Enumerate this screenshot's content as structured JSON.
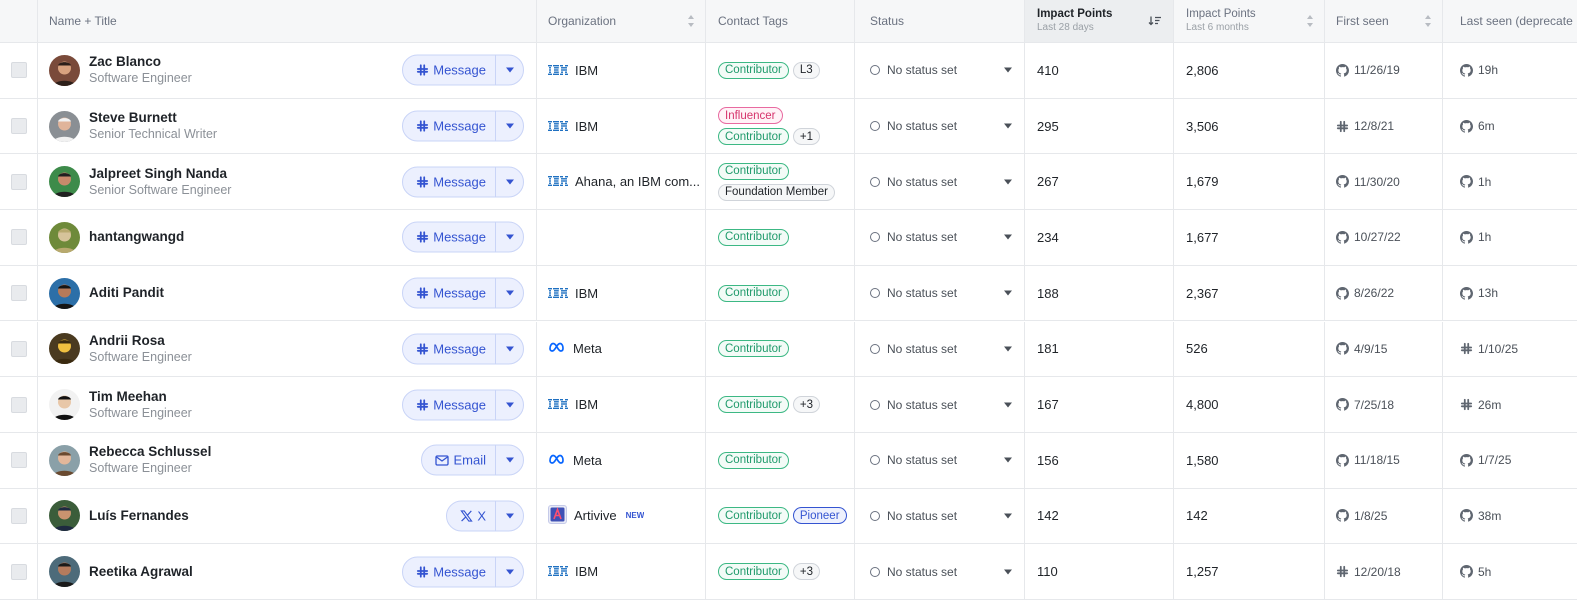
{
  "columns": {
    "name_title": "Name + Title",
    "organization": "Organization",
    "contact_tags": "Contact Tags",
    "status": "Status",
    "impact_28": "Impact Points",
    "impact_28_sub": "Last 28 days",
    "impact_6m": "Impact Points",
    "impact_6m_sub": "Last 6 months",
    "first_seen": "First seen",
    "last_seen": "Last seen (deprecate"
  },
  "status_text": "No status set",
  "rows": [
    {
      "name": "Zac Blanco",
      "title": "Software Engineer",
      "action": "Message",
      "action_icon": "slack-icon",
      "org": "IBM",
      "org_logo": "ibm-logo",
      "tags": [
        {
          "label": "Contributor",
          "kind": "contributor"
        },
        {
          "label": "L3",
          "kind": "gray"
        }
      ],
      "impact_28": "410",
      "impact_6m": "2,806",
      "first_seen": "11/26/19",
      "first_icon": "github-icon",
      "last_seen": "19h",
      "last_icon": "github-icon"
    },
    {
      "name": "Steve Burnett",
      "title": "Senior Technical Writer",
      "action": "Message",
      "action_icon": "slack-icon",
      "org": "IBM",
      "org_logo": "ibm-logo",
      "tags": [
        {
          "label": "Influencer",
          "kind": "influencer"
        },
        {
          "label": "Contributor",
          "kind": "contributor"
        },
        {
          "label": "+1",
          "kind": "gray"
        }
      ],
      "impact_28": "295",
      "impact_6m": "3,506",
      "first_seen": "12/8/21",
      "first_icon": "slack-icon",
      "last_seen": "6m",
      "last_icon": "github-icon"
    },
    {
      "name": "Jalpreet Singh Nanda",
      "title": "Senior Software Engineer",
      "action": "Message",
      "action_icon": "slack-icon",
      "org": "Ahana, an IBM com...",
      "org_logo": "ibm-logo",
      "tags": [
        {
          "label": "Contributor",
          "kind": "contributor"
        },
        {
          "label": "Foundation Member",
          "kind": "gray"
        }
      ],
      "impact_28": "267",
      "impact_6m": "1,679",
      "first_seen": "11/30/20",
      "first_icon": "github-icon",
      "last_seen": "1h",
      "last_icon": "github-icon"
    },
    {
      "name": "hantangwangd",
      "title": "",
      "action": "Message",
      "action_icon": "slack-icon",
      "org": "",
      "org_logo": "",
      "tags": [
        {
          "label": "Contributor",
          "kind": "contributor"
        }
      ],
      "impact_28": "234",
      "impact_6m": "1,677",
      "first_seen": "10/27/22",
      "first_icon": "github-icon",
      "last_seen": "1h",
      "last_icon": "github-icon"
    },
    {
      "name": "Aditi Pandit",
      "title": "",
      "action": "Message",
      "action_icon": "slack-icon",
      "org": "IBM",
      "org_logo": "ibm-logo",
      "tags": [
        {
          "label": "Contributor",
          "kind": "contributor"
        }
      ],
      "impact_28": "188",
      "impact_6m": "2,367",
      "first_seen": "8/26/22",
      "first_icon": "github-icon",
      "last_seen": "13h",
      "last_icon": "github-icon"
    },
    {
      "name": "Andrii Rosa",
      "title": "Software Engineer",
      "action": "Message",
      "action_icon": "slack-icon",
      "org": "Meta",
      "org_logo": "meta-logo",
      "tags": [
        {
          "label": "Contributor",
          "kind": "contributor"
        }
      ],
      "impact_28": "181",
      "impact_6m": "526",
      "first_seen": "4/9/15",
      "first_icon": "github-icon",
      "last_seen": "1/10/25",
      "last_icon": "slack-icon"
    },
    {
      "name": "Tim Meehan",
      "title": "Software Engineer",
      "action": "Message",
      "action_icon": "slack-icon",
      "org": "IBM",
      "org_logo": "ibm-logo",
      "tags": [
        {
          "label": "Contributor",
          "kind": "contributor"
        },
        {
          "label": "+3",
          "kind": "gray"
        }
      ],
      "impact_28": "167",
      "impact_6m": "4,800",
      "first_seen": "7/25/18",
      "first_icon": "github-icon",
      "last_seen": "26m",
      "last_icon": "slack-icon"
    },
    {
      "name": "Rebecca Schlussel",
      "title": "Software Engineer",
      "action": "Email",
      "action_icon": "mail-icon",
      "org": "Meta",
      "org_logo": "meta-logo",
      "tags": [
        {
          "label": "Contributor",
          "kind": "contributor"
        }
      ],
      "impact_28": "156",
      "impact_6m": "1,580",
      "first_seen": "11/18/15",
      "first_icon": "github-icon",
      "last_seen": "1/7/25",
      "last_icon": "github-icon"
    },
    {
      "name": "Luís Fernandes",
      "title": "",
      "action": "X",
      "action_icon": "x-icon",
      "org": "Artivive",
      "org_logo": "artivive-logo",
      "org_badge": "NEW",
      "tags": [
        {
          "label": "Contributor",
          "kind": "contributor"
        },
        {
          "label": "Pioneer",
          "kind": "pioneer"
        }
      ],
      "impact_28": "142",
      "impact_6m": "142",
      "first_seen": "1/8/25",
      "first_icon": "github-icon",
      "last_seen": "38m",
      "last_icon": "github-icon"
    },
    {
      "name": "Reetika Agrawal",
      "title": "",
      "action": "Message",
      "action_icon": "slack-icon",
      "org": "IBM",
      "org_logo": "ibm-logo",
      "tags": [
        {
          "label": "Contributor",
          "kind": "contributor"
        },
        {
          "label": "+3",
          "kind": "gray"
        }
      ],
      "impact_28": "110",
      "impact_6m": "1,257",
      "first_seen": "12/20/18",
      "first_icon": "slack-icon",
      "last_seen": "5h",
      "last_icon": "github-icon"
    }
  ],
  "colors": {
    "accent": "#3454d1",
    "contributor": "#1f9a6b",
    "influencer": "#d6336c",
    "ibm": "#1f70c1",
    "meta": "#0866ff"
  }
}
